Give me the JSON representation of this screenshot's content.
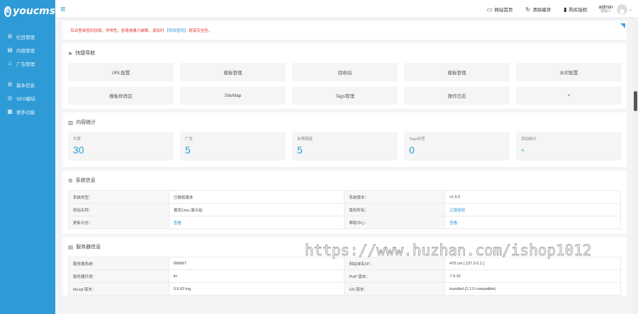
{
  "brand": {
    "logo_letter": "E",
    "logo_text": "youcms"
  },
  "colors": {
    "accent": "#2e9bd6",
    "notice": "#e53935"
  },
  "sidebar": {
    "items": [
      {
        "icon": "gear-icon",
        "glyph": "⚙",
        "label": "栏目管理"
      },
      {
        "icon": "document-icon",
        "glyph": "▤",
        "label": "内容管理"
      },
      {
        "icon": "megaphone-icon",
        "glyph": "⌂",
        "label": "广告管理"
      },
      {
        "icon": "settings-icon",
        "glyph": "⚙",
        "label": "基本信息"
      },
      {
        "icon": "globe-icon",
        "glyph": "◎",
        "label": "SEO模块"
      },
      {
        "icon": "grid-icon",
        "glyph": "▦",
        "label": "更多功能"
      }
    ]
  },
  "topbar": {
    "links": [
      {
        "icon": "monitor-icon",
        "glyph": "▭",
        "label": "网站首页"
      },
      {
        "icon": "refresh-icon",
        "glyph": "↻",
        "label": "清除缓存"
      },
      {
        "icon": "bookmark-icon",
        "glyph": "▮",
        "label": "购买授权"
      }
    ],
    "user": {
      "name": "admin",
      "role": "创始人"
    }
  },
  "notice": {
    "prefix": "· 后台登录密码较弱，非常危，容易被暴力破解，请及时",
    "link": "【修改密码】",
    "suffix": "提高安全性。"
  },
  "quick_nav": {
    "title": "快捷导航",
    "items": [
      "URL配置",
      "模板管理",
      "回收站",
      "模板管理",
      "水印配置",
      "模板修改区",
      "SiteMap",
      "Tags管理",
      "操作日志",
      "+"
    ]
  },
  "stats": {
    "title": "内容统计",
    "items": [
      {
        "label": "文章",
        "value": "30"
      },
      {
        "label": "广告",
        "value": "5"
      },
      {
        "label": "友情链接",
        "value": "5"
      },
      {
        "label": "Tags标签",
        "value": "0"
      },
      {
        "label": "添加统计",
        "value": "+"
      }
    ]
  },
  "system_info": {
    "title": "系统信息",
    "rows": [
      {
        "k1": "系统类型：",
        "v1": "已授权版本",
        "k2": "系统版本：",
        "v2": "v1.5.6",
        "link2": false
      },
      {
        "k1": "网站名称：",
        "v1": "易优Cms-演示站",
        "k2": "版权所有：",
        "v2": "正版授权",
        "link2": true
      },
      {
        "k1": "更新日志：",
        "v1": "查看",
        "link1": true,
        "k2": "帮助中心：",
        "v2": "查看",
        "link2": true
      }
    ]
  },
  "server_info": {
    "title": "服务器信息",
    "rows": [
      {
        "k1": "服务器系统：",
        "v1": "WINNT",
        "k2": "网站域名/IP：",
        "v2": "470.cm [ 127.0.0.1 ]"
      },
      {
        "k1": "服务器环境：",
        "v1": "iis",
        "k2": "PHP 版本：",
        "v2": "7.4.16"
      },
      {
        "k1": "Mysql 版本：",
        "v1": "5.5.62-log",
        "k2": "GD 版本：",
        "v2": "bundled (2.1.0 compatible)"
      }
    ]
  },
  "watermark": "https://www.huzhan.com/ishop1012"
}
